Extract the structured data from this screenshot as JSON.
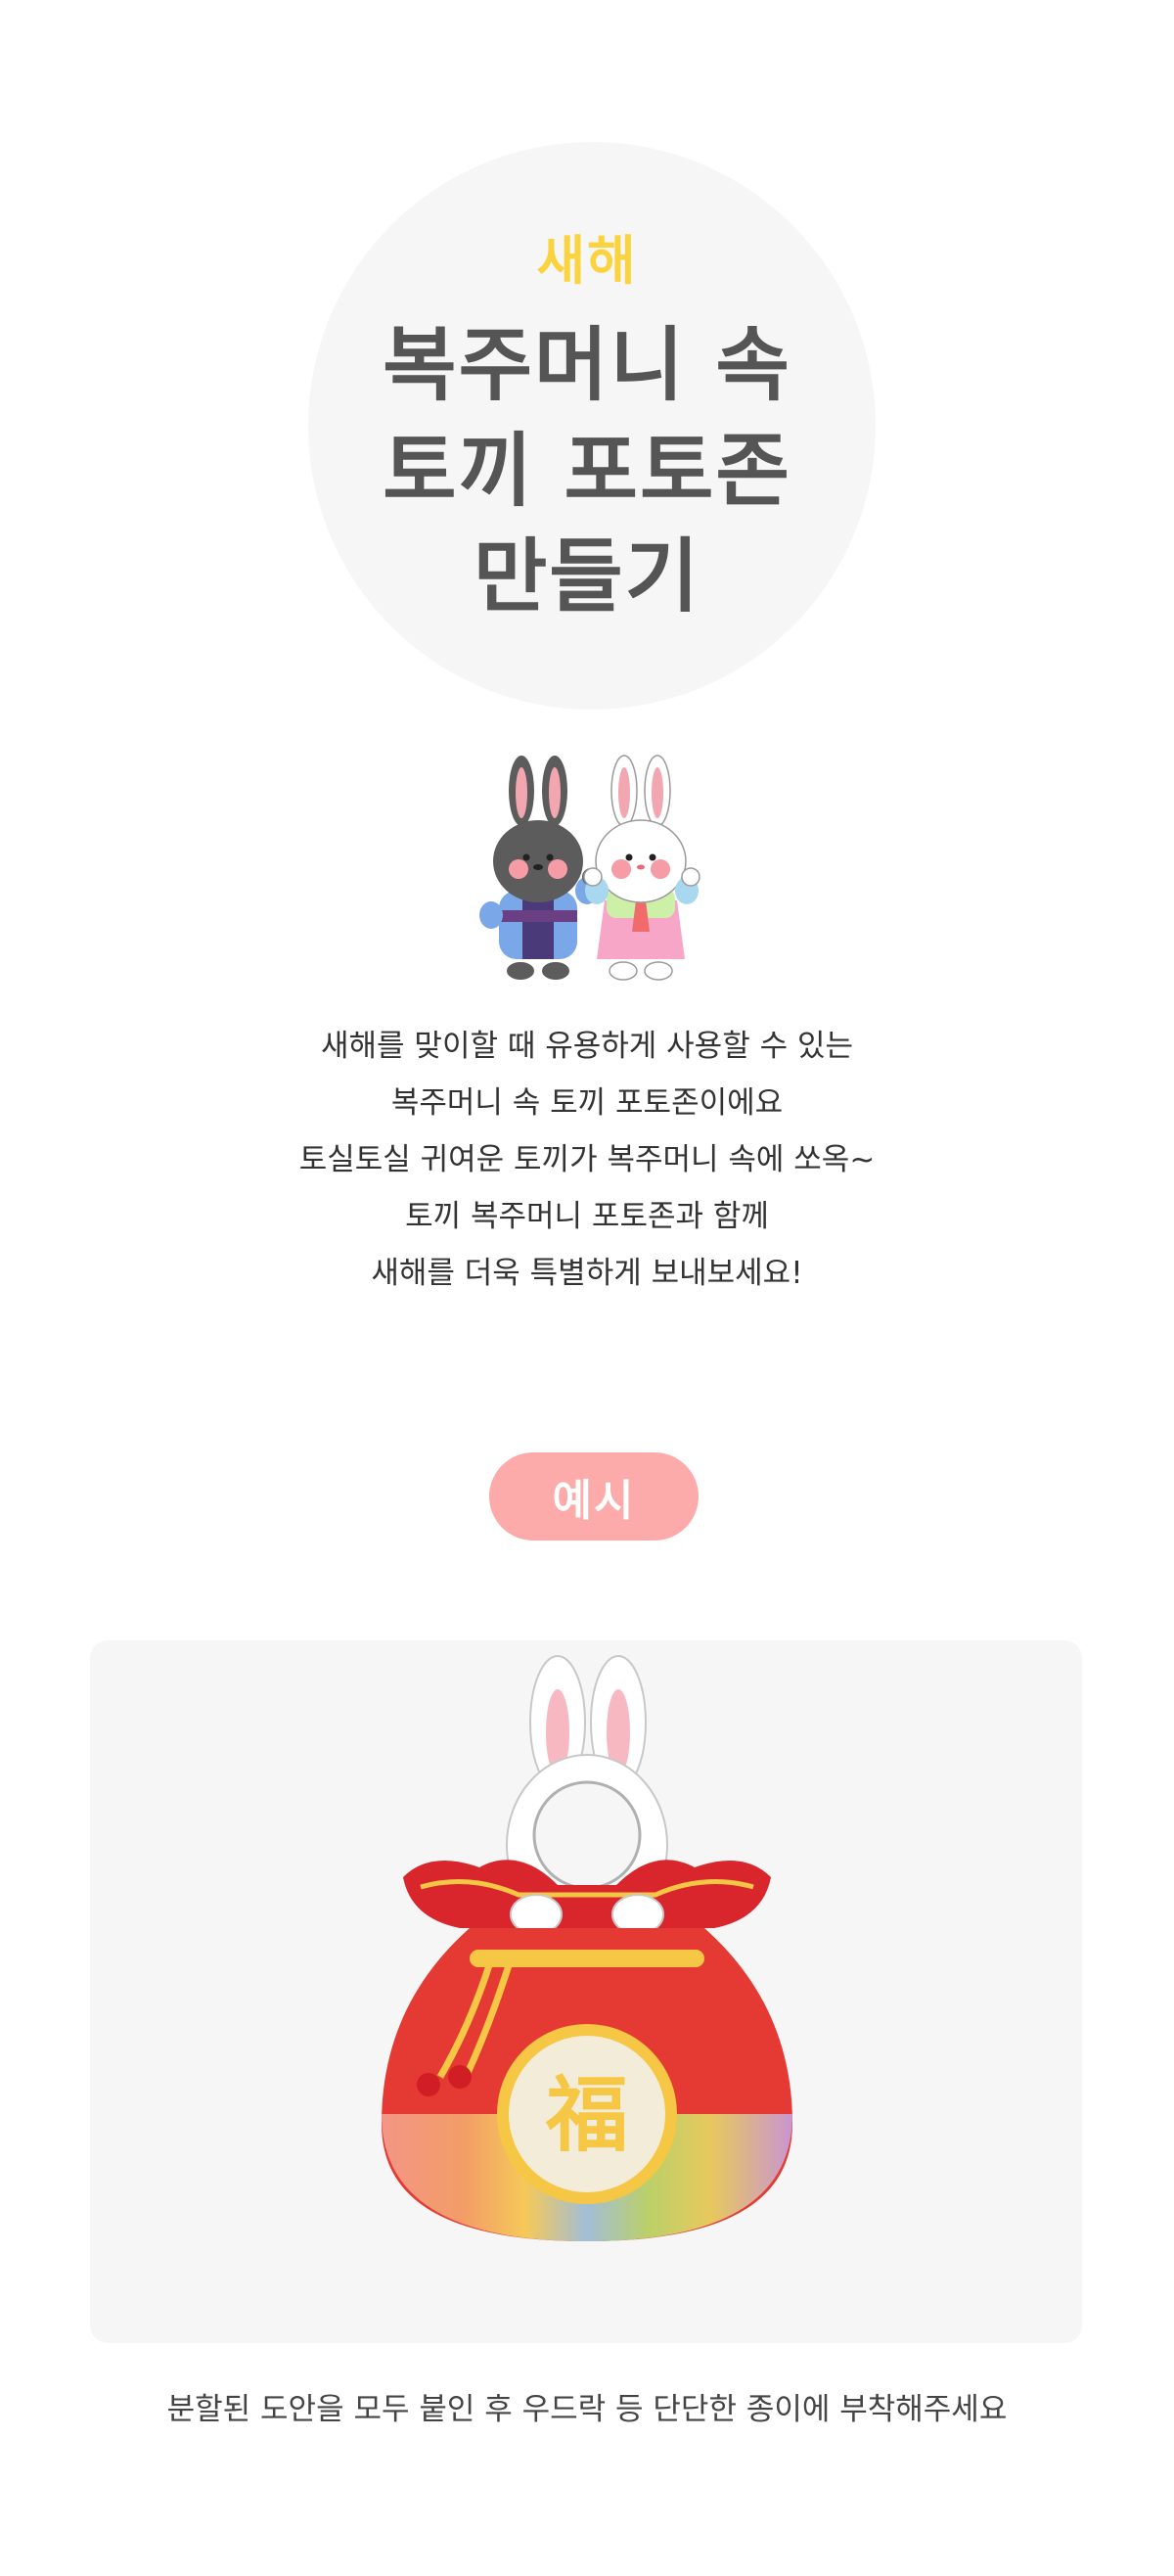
{
  "hero": {
    "subtitle": "새해",
    "title_lines": [
      "복주머니 속",
      "토끼 포토존",
      "만들기"
    ]
  },
  "description": {
    "lines": [
      "새해를 맞이할 때 유용하게 사용할 수 있는",
      "복주머니 속 토끼 포토존이에요",
      "토실토실 귀여운 토끼가 복주머니 속에 쏘옥~",
      "토끼 복주머니 포토존과 함께",
      "새해를 더욱 특별하게 보내보세요!"
    ]
  },
  "example": {
    "badge_label": "예시",
    "pouch_character": "福"
  },
  "caption": "분할된 도안을 모두 붙인 후 우드락 등 단단한 종이에 부착해주세요",
  "colors": {
    "accent_yellow": "#fbd33f",
    "badge_pink": "#fcaaaa",
    "title_gray": "#555555",
    "panel_bg": "#f6f6f6"
  }
}
